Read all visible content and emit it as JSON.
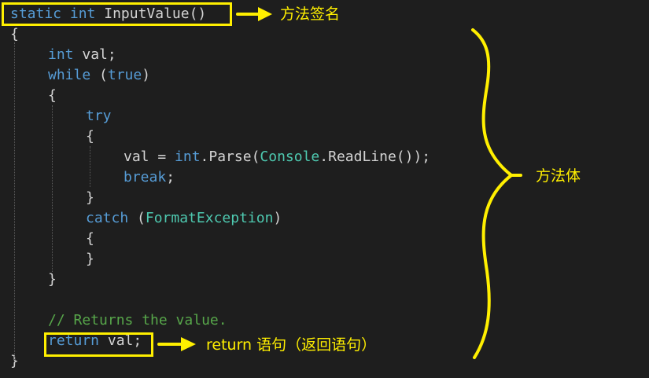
{
  "code": {
    "lines": [
      {
        "indent": 0,
        "tokens": [
          {
            "t": "static",
            "c": "kw"
          },
          {
            "t": " ",
            "c": "pl"
          },
          {
            "t": "int",
            "c": "kw"
          },
          {
            "t": " InputValue()",
            "c": "pl"
          }
        ]
      },
      {
        "indent": 0,
        "tokens": [
          {
            "t": "{",
            "c": "pl"
          }
        ]
      },
      {
        "indent": 1,
        "tokens": [
          {
            "t": "int",
            "c": "kw"
          },
          {
            "t": " val;",
            "c": "pl"
          }
        ]
      },
      {
        "indent": 1,
        "tokens": [
          {
            "t": "while",
            "c": "kw"
          },
          {
            "t": " (",
            "c": "pl"
          },
          {
            "t": "true",
            "c": "kw"
          },
          {
            "t": ")",
            "c": "pl"
          }
        ]
      },
      {
        "indent": 1,
        "tokens": [
          {
            "t": "{",
            "c": "pl"
          }
        ]
      },
      {
        "indent": 2,
        "tokens": [
          {
            "t": "try",
            "c": "kw"
          }
        ]
      },
      {
        "indent": 2,
        "tokens": [
          {
            "t": "{",
            "c": "pl"
          }
        ]
      },
      {
        "indent": 3,
        "tokens": [
          {
            "t": "val = ",
            "c": "pl"
          },
          {
            "t": "int",
            "c": "kw"
          },
          {
            "t": ".Parse(",
            "c": "pl"
          },
          {
            "t": "Console",
            "c": "type"
          },
          {
            "t": ".ReadLine());",
            "c": "pl"
          }
        ]
      },
      {
        "indent": 3,
        "tokens": [
          {
            "t": "break",
            "c": "kw"
          },
          {
            "t": ";",
            "c": "pl"
          }
        ]
      },
      {
        "indent": 2,
        "tokens": [
          {
            "t": "}",
            "c": "pl"
          }
        ]
      },
      {
        "indent": 2,
        "tokens": [
          {
            "t": "catch",
            "c": "kw"
          },
          {
            "t": " (",
            "c": "pl"
          },
          {
            "t": "FormatException",
            "c": "type"
          },
          {
            "t": ")",
            "c": "pl"
          }
        ]
      },
      {
        "indent": 2,
        "tokens": [
          {
            "t": "{",
            "c": "pl"
          }
        ]
      },
      {
        "indent": 2,
        "tokens": [
          {
            "t": "}",
            "c": "pl"
          }
        ]
      },
      {
        "indent": 1,
        "tokens": [
          {
            "t": "}",
            "c": "pl"
          }
        ]
      },
      {
        "indent": 0,
        "tokens": []
      },
      {
        "indent": 1,
        "tokens": [
          {
            "t": "// Returns the value.",
            "c": "com"
          }
        ]
      },
      {
        "indent": 1,
        "tokens": [
          {
            "t": "return",
            "c": "kw"
          },
          {
            "t": " val;",
            "c": "pl"
          }
        ]
      },
      {
        "indent": 0,
        "tokens": [
          {
            "t": "}",
            "c": "pl"
          }
        ]
      }
    ]
  },
  "annotations": {
    "signature_label": "方法签名",
    "body_label": "方法体",
    "return_label": "return 语句（返回语句）"
  },
  "colors": {
    "background": "#1e1e1e",
    "keyword": "#569cd6",
    "type": "#4ec9b0",
    "comment": "#57a64a",
    "plain": "#d4d4d4",
    "annotation": "#ffef00"
  }
}
